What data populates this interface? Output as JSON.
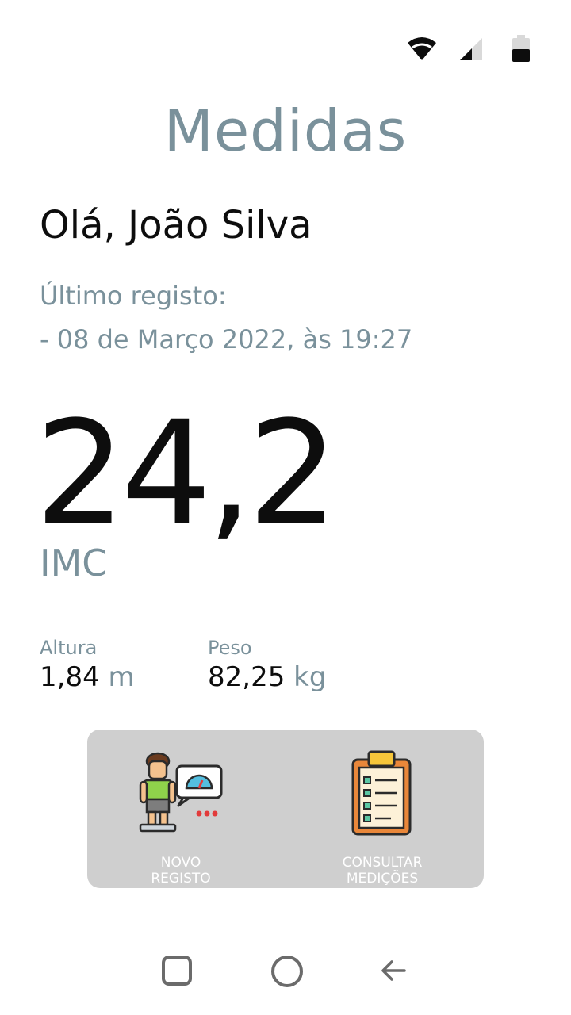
{
  "status_bar": {
    "icons": [
      "wifi-icon",
      "signal-icon",
      "battery-icon"
    ]
  },
  "header": {
    "title": "Medidas"
  },
  "greeting": "Olá, João Silva",
  "last_record": {
    "label": "Último registo:",
    "date": "- 08 de Março 2022, às 19:27"
  },
  "imc": {
    "value": "24,2",
    "label": "IMC"
  },
  "metrics": {
    "altura": {
      "label": "Altura",
      "value": "1,84",
      "unit": "m"
    },
    "peso": {
      "label": "Peso",
      "value": "82,25",
      "unit": "kg"
    }
  },
  "actions": {
    "novo_registo": {
      "label": "NOVO\nREGISTO",
      "icon": "person-on-scale-icon"
    },
    "consultar": {
      "label": "CONSULTAR\nMEDIÇÕES",
      "icon": "clipboard-checklist-icon"
    }
  },
  "nav_bar": {
    "icons": [
      "recent-apps-icon",
      "home-icon",
      "back-icon"
    ]
  },
  "colors": {
    "accent": "#7a919b",
    "text": "#0d0d0d",
    "panel": "#cfcfcf"
  }
}
